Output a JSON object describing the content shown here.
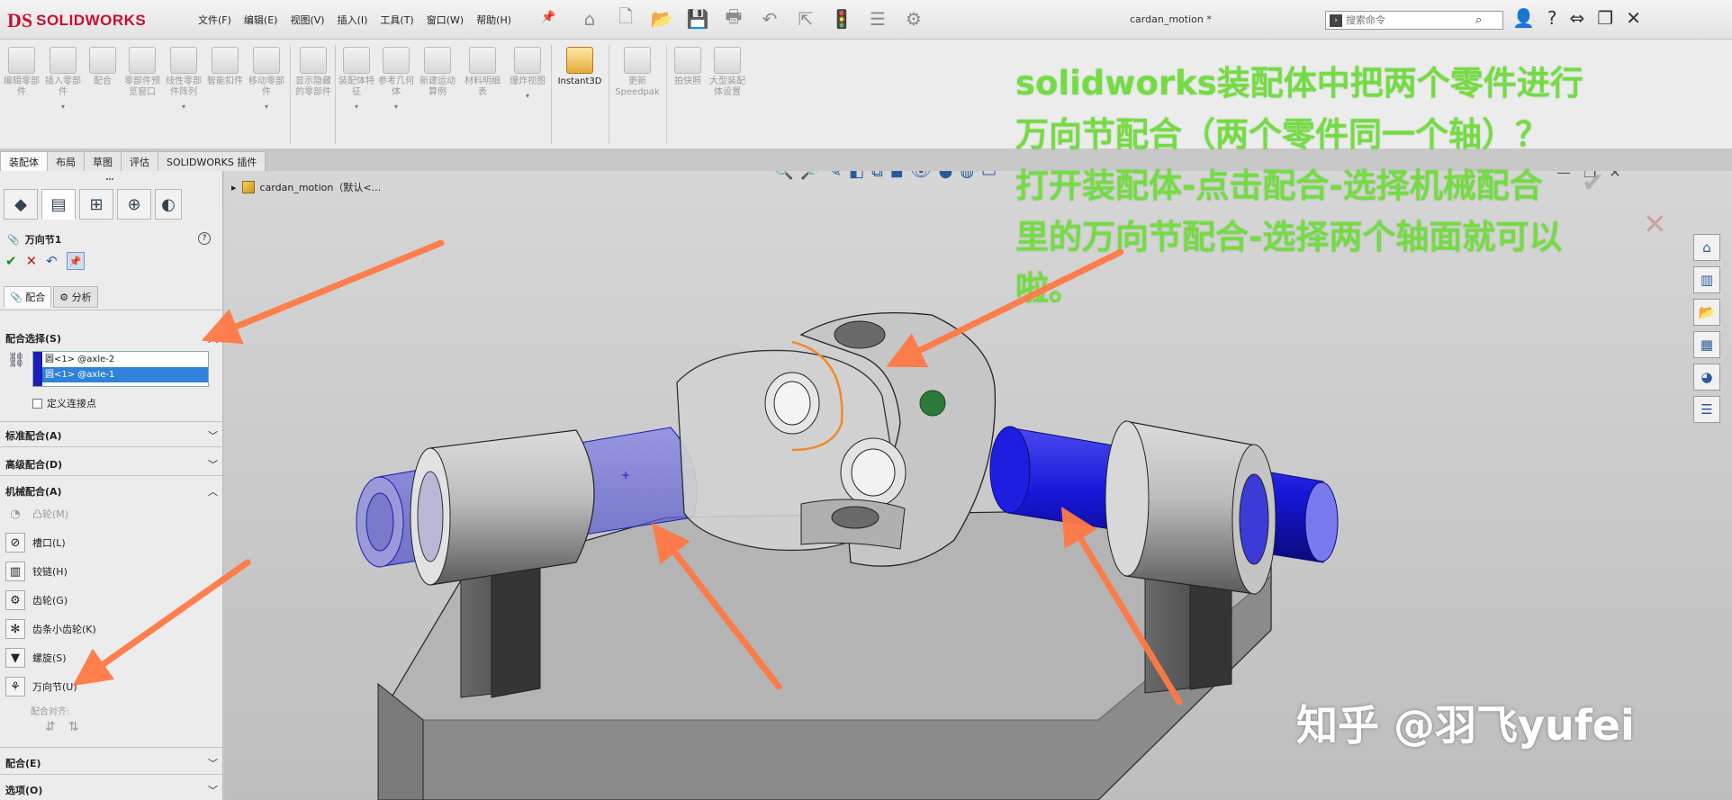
{
  "app": {
    "logo_ds": "DS",
    "logo_text": "SOLIDWORKS",
    "document_title": "cardan_motion *",
    "search_placeholder": "搜索命令"
  },
  "menu": [
    "文件(F)",
    "编辑(E)",
    "视图(V)",
    "插入(I)",
    "工具(T)",
    "窗口(W)",
    "帮助(H)"
  ],
  "ribbon": [
    {
      "label": "编辑零部件",
      "active": false
    },
    {
      "label": "插入零部件",
      "active": false
    },
    {
      "label": "配合",
      "active": false
    },
    {
      "label": "零部件预览窗口",
      "active": false
    },
    {
      "label": "线性零部件阵列",
      "active": false
    },
    {
      "label": "智能扣件",
      "active": false
    },
    {
      "label": "移动零部件",
      "active": false
    },
    {
      "label": "显示隐藏的零部件",
      "active": false
    },
    {
      "label": "装配体特征",
      "active": false
    },
    {
      "label": "参考几何体",
      "active": false
    },
    {
      "label": "新建运动算例",
      "active": false
    },
    {
      "label": "材料明细表",
      "active": false
    },
    {
      "label": "爆炸视图",
      "active": false
    },
    {
      "label": "Instant3D",
      "active": true
    },
    {
      "label": "更新Speedpak",
      "active": false
    },
    {
      "label": "拍快照",
      "active": false
    },
    {
      "label": "大型装配体设置",
      "active": false
    }
  ],
  "command_tabs": [
    {
      "label": "装配体",
      "active": true
    },
    {
      "label": "布局",
      "active": false
    },
    {
      "label": "草图",
      "active": false
    },
    {
      "label": "评估",
      "active": false
    },
    {
      "label": "SOLIDWORKS 插件",
      "active": false
    }
  ],
  "property_manager": {
    "title": "万向节1",
    "help": "?",
    "subtabs": [
      {
        "label": "配合",
        "active": true
      },
      {
        "label": "分析",
        "active": false
      }
    ],
    "mate_selection_header": "配合选择(S)",
    "selections": [
      {
        "text": "圆<1> @axle-2",
        "highlight": false
      },
      {
        "text": "圆<1> @axle-1",
        "highlight": true
      }
    ],
    "define_point_label": "定义连接点",
    "standard_header": "标准配合(A)",
    "advanced_header": "高级配合(D)",
    "mechanical_header": "机械配合(A)",
    "mechanical_items": [
      {
        "label": "凸轮(M)",
        "icon": "cam-icon",
        "disabled": true
      },
      {
        "label": "槽口(L)",
        "icon": "slot-icon",
        "disabled": false
      },
      {
        "label": "铰链(H)",
        "icon": "hinge-icon",
        "disabled": false
      },
      {
        "label": "齿轮(G)",
        "icon": "gear-mate-icon",
        "disabled": false
      },
      {
        "label": "齿条小齿轮(K)",
        "icon": "rack-pinion-icon",
        "disabled": false
      },
      {
        "label": "螺旋(S)",
        "icon": "screw-icon",
        "disabled": false
      },
      {
        "label": "万向节(U)",
        "icon": "universal-joint-icon",
        "disabled": false
      }
    ],
    "alignment_label": "配合对齐:",
    "mates_header": "配合(E)",
    "options_header": "选项(O)"
  },
  "viewport": {
    "tree_label": "cardan_motion（默认<..."
  },
  "annotation_lines": [
    "solidworks装配体中把两个零件进行",
    "万向节配合（两个零件同一个轴）？",
    "打开装配体-点击配合-选择机械配合",
    "里的万向节配合-选择两个轴面就可以",
    "啦。"
  ],
  "watermark": "知乎 @羽飞yufei",
  "colors": {
    "annotation": "#74dc42",
    "arrow": "#ff7a45",
    "selected_face": "#1a1ad8",
    "brand": "#c8102e"
  }
}
